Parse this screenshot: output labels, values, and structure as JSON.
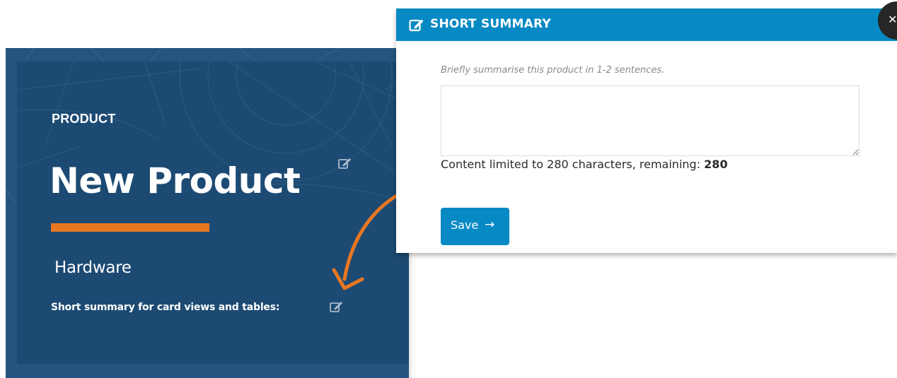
{
  "card": {
    "eyebrow": "PRODUCT",
    "title": "New Product",
    "category": "Hardware",
    "summary_label": "Short summary for card views and tables:",
    "title_edit_icon": "edit-icon",
    "summary_edit_icon": "edit-icon",
    "accent_color": "#e87722",
    "background_color": "#1c4a73"
  },
  "modal": {
    "title": "SHORT SUMMARY",
    "header_icon": "edit-icon",
    "close_icon": "close-icon",
    "hint": "Briefly summarise this product in 1-2 sentences.",
    "textarea_value": "",
    "limit_prefix": "Content limited to 280 characters, remaining: ",
    "remaining": "280",
    "save_label": "Save",
    "save_icon": "arrow-right-icon",
    "header_color": "#0789c4"
  },
  "annotation": {
    "arrow_icon": "curved-arrow-icon",
    "arrow_color": "#e87722"
  }
}
